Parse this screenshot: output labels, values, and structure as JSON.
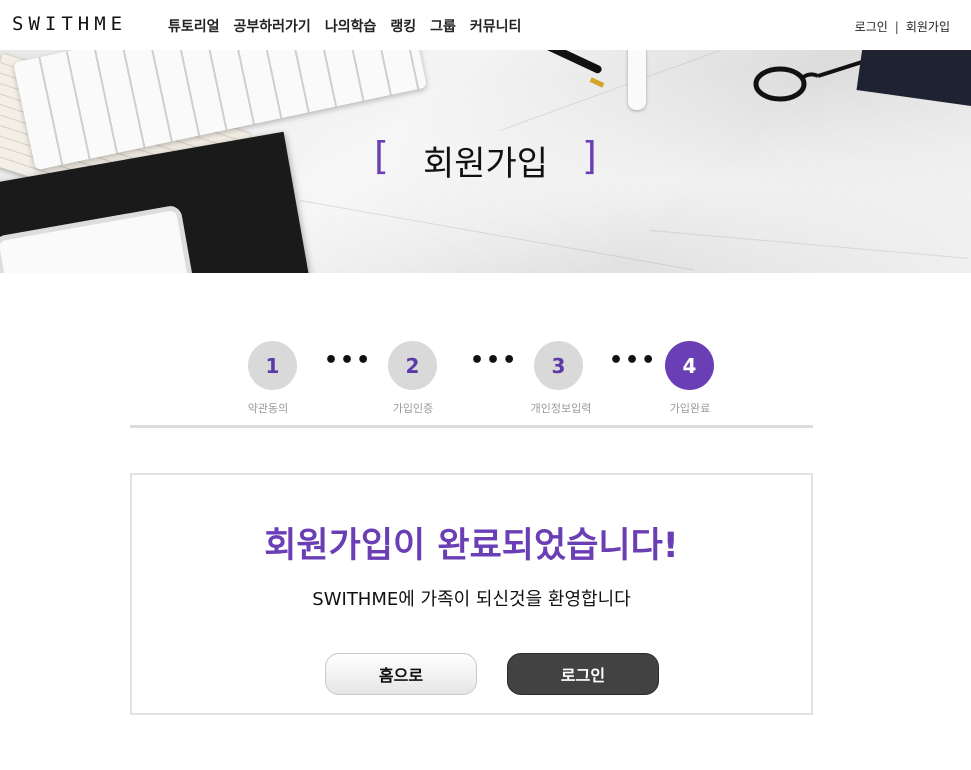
{
  "header": {
    "logo": "SWITHME",
    "nav": [
      "튜토리얼",
      "공부하러가기",
      "나의학습",
      "랭킹",
      "그룹",
      "커뮤니티"
    ],
    "login": "로그인",
    "separator": "|",
    "signup": "회원가입"
  },
  "hero": {
    "title": "회원가입",
    "bracket_left": "[",
    "bracket_right": "]"
  },
  "steps": [
    {
      "number": "1",
      "label": "약관동의",
      "active": false
    },
    {
      "number": "2",
      "label": "가입인증",
      "active": false
    },
    {
      "number": "3",
      "label": "개인정보입력",
      "active": false
    },
    {
      "number": "4",
      "label": "가입완료",
      "active": true
    }
  ],
  "step_separator": "•••",
  "completion": {
    "title": "회원가입이 완료되었습니다!",
    "message": "SWITHME에 가족이 되신것을 환영합니다",
    "home_button": "홈으로",
    "login_button": "로그인"
  },
  "colors": {
    "accent": "#6a3fb5",
    "step_inactive": "#d9d9d9",
    "login_button": "#424242"
  }
}
